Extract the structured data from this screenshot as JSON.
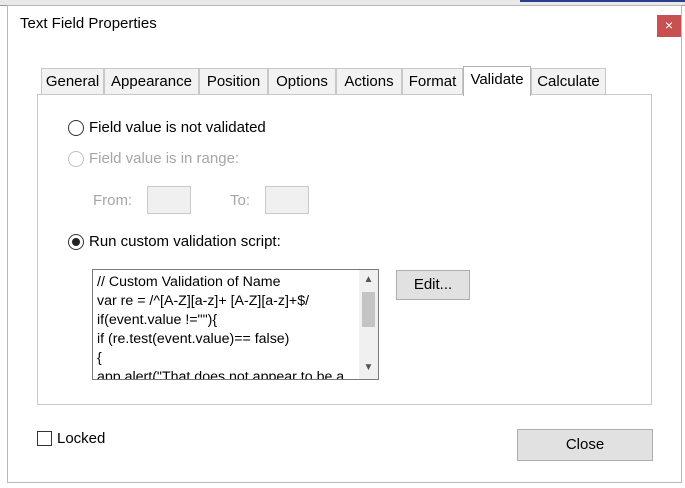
{
  "dialog": {
    "title": "Text Field Properties",
    "close_glyph": "×"
  },
  "tabs": [
    {
      "label": "General"
    },
    {
      "label": "Appearance"
    },
    {
      "label": "Position"
    },
    {
      "label": "Options"
    },
    {
      "label": "Actions"
    },
    {
      "label": "Format"
    },
    {
      "label": "Validate",
      "active": true
    },
    {
      "label": "Calculate"
    }
  ],
  "validate": {
    "option_not_validated": "Field value is not validated",
    "option_in_range": "Field value is in range:",
    "from_label": "From:",
    "to_label": "To:",
    "from_value": "",
    "to_value": "",
    "option_custom_script": "Run custom validation script:",
    "selected_option": "custom_script",
    "script_lines": [
      "// Custom Validation of Name",
      "var re = /^[A-Z][a-z]+ [A-Z][a-z]+$/",
      "if(event.value !=\"\"){",
      "if (re.test(event.value)== false)",
      "{",
      "app.alert(\"That does not appear to be a"
    ],
    "edit_button": "Edit..."
  },
  "footer": {
    "locked_label": "Locked",
    "locked_checked": false,
    "close_button": "Close"
  },
  "icons": {
    "scroll_up": "▲",
    "scroll_down": "▼"
  }
}
